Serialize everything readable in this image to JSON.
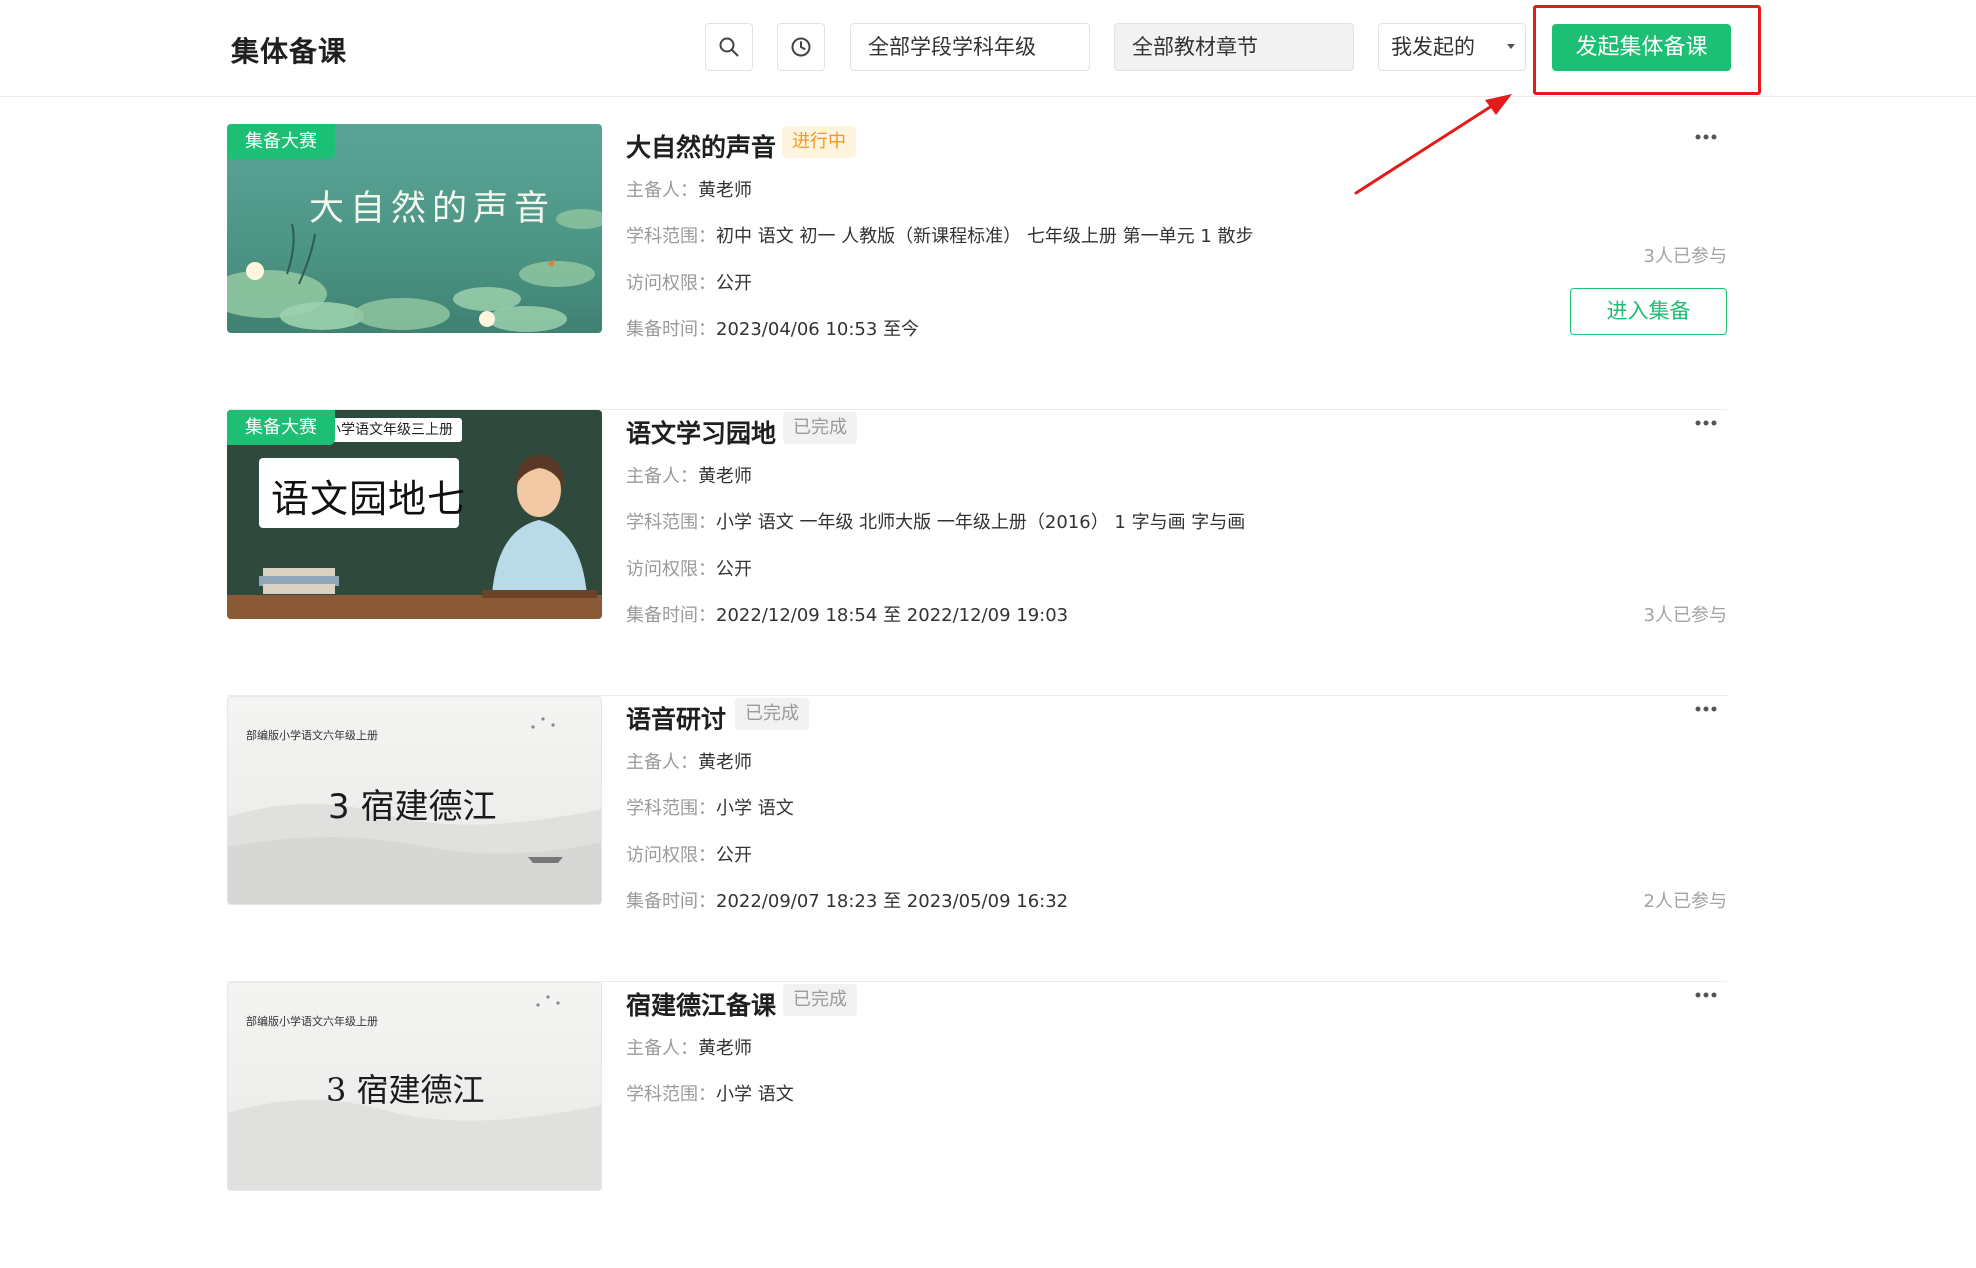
{
  "header": {
    "title": "集体备课",
    "filter_grade": "全部学段学科年级",
    "filter_chapter": "全部教材章节",
    "select_scope": "我发起的",
    "create_button": "发起集体备课"
  },
  "labels": {
    "host": "主备人：",
    "scope": "学科范围：",
    "access": "访问权限：",
    "time": "集备时间："
  },
  "cards": [
    {
      "badge": "集备大赛",
      "thumb_text": "大自然的声音",
      "title": "大自然的声音",
      "status": "进行中",
      "host": "黄老师",
      "scope": "初中 语文 初一 人教版（新课程标准） 七年级上册 第一单元 1 散步",
      "access": "公开",
      "time": "2023/04/06 10:53 至今",
      "participants": "3人已参与",
      "enter_button": "进入集备"
    },
    {
      "badge": "集备大赛",
      "thumb_subtitle": "小学语文年级三上册",
      "thumb_text": "语文园地七",
      "title": "语文学习园地",
      "status": "已完成",
      "host": "黄老师",
      "scope": "小学 语文 一年级 北师大版 一年级上册（2016） 1 字与画 字与画",
      "access": "公开",
      "time": "2022/12/09 18:54 至 2022/12/09 19:03",
      "participants": "3人已参与"
    },
    {
      "thumb_subtitle": "部编版小学语文六年级上册",
      "thumb_text": "3 宿建德江",
      "title": "语音研讨",
      "status": "已完成",
      "host": "黄老师",
      "scope": "小学 语文",
      "access": "公开",
      "time": "2022/09/07 18:23 至 2023/05/09 16:32",
      "participants": "2人已参与"
    },
    {
      "thumb_subtitle": "部编版小学语文六年级上册",
      "thumb_text": "3 宿建德江",
      "title": "宿建德江备课",
      "status": "已完成",
      "host": "黄老师",
      "scope": "小学 语文"
    }
  ],
  "colors": {
    "primary": "#1cbf73",
    "highlight": "#e31b1b",
    "ongoing": "#f39a1e"
  }
}
